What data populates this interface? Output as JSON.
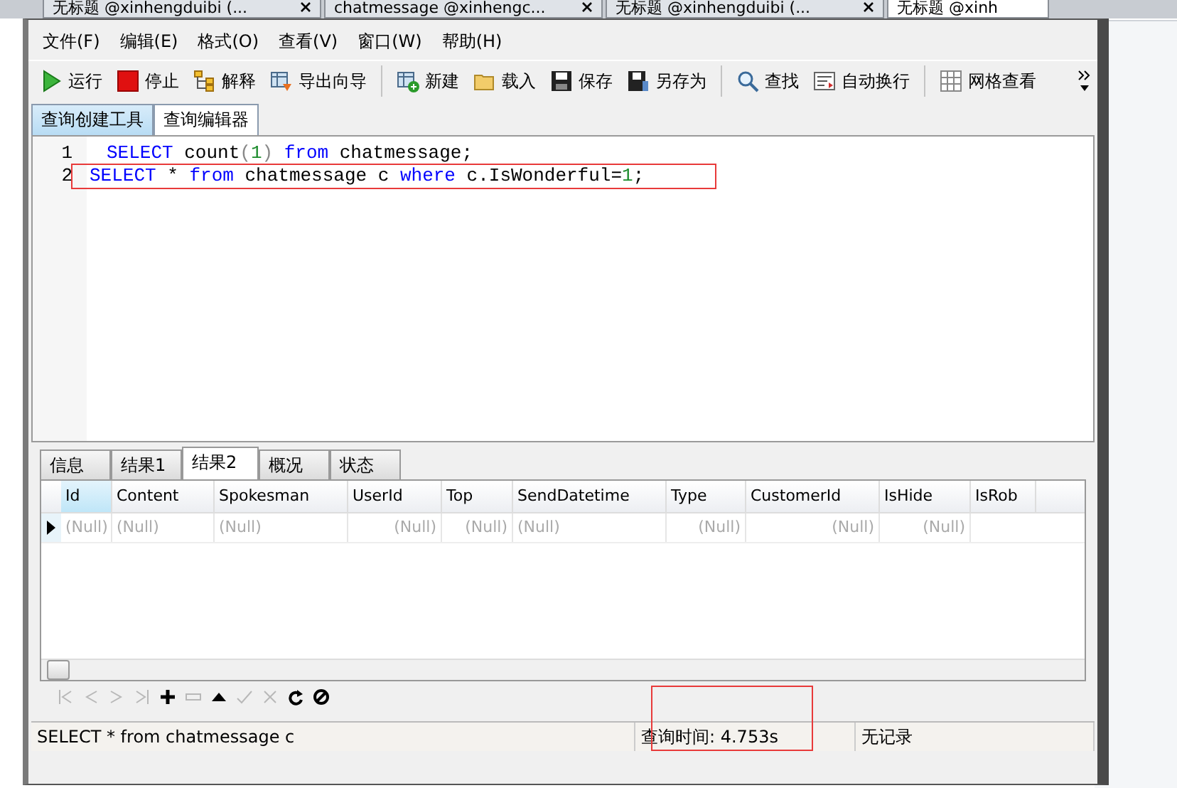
{
  "doc_tabs": [
    {
      "label": "无标题 @xinhengduibi (...",
      "selected": false
    },
    {
      "label": "chatmessage @xinhengc...",
      "selected": false
    },
    {
      "label": "无标题 @xinhengduibi (...",
      "selected": false
    },
    {
      "label": "无标题 @xinh",
      "selected": true
    }
  ],
  "menu": [
    "文件(F)",
    "编辑(E)",
    "格式(O)",
    "查看(V)",
    "窗口(W)",
    "帮助(H)"
  ],
  "toolbar": [
    {
      "kind": "run",
      "label": "运行"
    },
    {
      "kind": "stop",
      "label": "停止"
    },
    {
      "kind": "explain",
      "label": "解释"
    },
    {
      "kind": "export",
      "label": "导出向导"
    },
    {
      "kind": "sep"
    },
    {
      "kind": "new",
      "label": "新建"
    },
    {
      "kind": "load",
      "label": "载入"
    },
    {
      "kind": "save",
      "label": "保存"
    },
    {
      "kind": "saveas",
      "label": "另存为"
    },
    {
      "kind": "sep"
    },
    {
      "kind": "find",
      "label": "查找"
    },
    {
      "kind": "wrap",
      "label": "自动换行"
    },
    {
      "kind": "sep"
    },
    {
      "kind": "grid",
      "label": "网格查看"
    }
  ],
  "editor_tabs": [
    {
      "label": "查询创建工具",
      "selected": false
    },
    {
      "label": "查询编辑器",
      "selected": true
    }
  ],
  "code_lines": [
    {
      "number": "1",
      "highlighted": false,
      "tokens": [
        {
          "text": "SELECT",
          "kind": "keyword"
        },
        {
          "text": " count",
          "kind": "plain"
        },
        {
          "text": "(",
          "kind": "punct"
        },
        {
          "text": "1",
          "kind": "number"
        },
        {
          "text": ")",
          "kind": "punct"
        },
        {
          "text": " from",
          "kind": "keyword"
        },
        {
          "text": " chatmessage;",
          "kind": "plain"
        }
      ]
    },
    {
      "number": "2",
      "highlighted": true,
      "tokens": [
        {
          "text": "SELECT",
          "kind": "keyword"
        },
        {
          "text": " * ",
          "kind": "plain"
        },
        {
          "text": "from",
          "kind": "keyword"
        },
        {
          "text": " chatmessage c ",
          "kind": "plain"
        },
        {
          "text": "where",
          "kind": "keyword"
        },
        {
          "text": " c.IsWonderful=",
          "kind": "plain"
        },
        {
          "text": "1",
          "kind": "number"
        },
        {
          "text": ";",
          "kind": "plain"
        }
      ]
    }
  ],
  "result_tabs": [
    {
      "label": "信息",
      "selected": false
    },
    {
      "label": "结果1",
      "selected": false
    },
    {
      "label": "结果2",
      "selected": true
    },
    {
      "label": "概况",
      "selected": false
    },
    {
      "label": "状态",
      "selected": false
    }
  ],
  "grid": {
    "columns": [
      {
        "label": "Id",
        "kind": "number",
        "selected": true
      },
      {
        "label": "Content",
        "kind": "text",
        "selected": false
      },
      {
        "label": "Spokesman",
        "kind": "text",
        "selected": false
      },
      {
        "label": "UserId",
        "kind": "number",
        "selected": false
      },
      {
        "label": "Top",
        "kind": "number",
        "selected": false
      },
      {
        "label": "SendDatetime",
        "kind": "text",
        "selected": false
      },
      {
        "label": "Type",
        "kind": "number",
        "selected": false
      },
      {
        "label": "CustomerId",
        "kind": "number",
        "selected": false
      },
      {
        "label": "IsHide",
        "kind": "number",
        "selected": false
      },
      {
        "label": "IsRob",
        "selected": false
      }
    ],
    "rows": [
      {
        "cells": [
          "(Null)",
          "(Null)",
          "(Null)",
          "(Null)",
          "(Null)",
          "(Null)",
          "(Null)",
          "(Null)",
          "(Null)"
        ]
      }
    ]
  },
  "nav_buttons": [
    {
      "kind": "first",
      "disabled": true
    },
    {
      "kind": "prev",
      "disabled": true
    },
    {
      "kind": "next",
      "disabled": true
    },
    {
      "kind": "last",
      "disabled": true
    },
    {
      "kind": "add",
      "disabled": false
    },
    {
      "kind": "remove",
      "disabled": true
    },
    {
      "kind": "up",
      "disabled": false
    },
    {
      "kind": "apply",
      "disabled": true
    },
    {
      "kind": "cancel",
      "disabled": true
    },
    {
      "kind": "refresh",
      "disabled": false
    },
    {
      "kind": "halt",
      "disabled": false
    }
  ],
  "status_bar": {
    "query": "SELECT * from chatmessage c",
    "time": "查询时间: 4.753s",
    "records": "无记录",
    "time_highlighted": true
  }
}
